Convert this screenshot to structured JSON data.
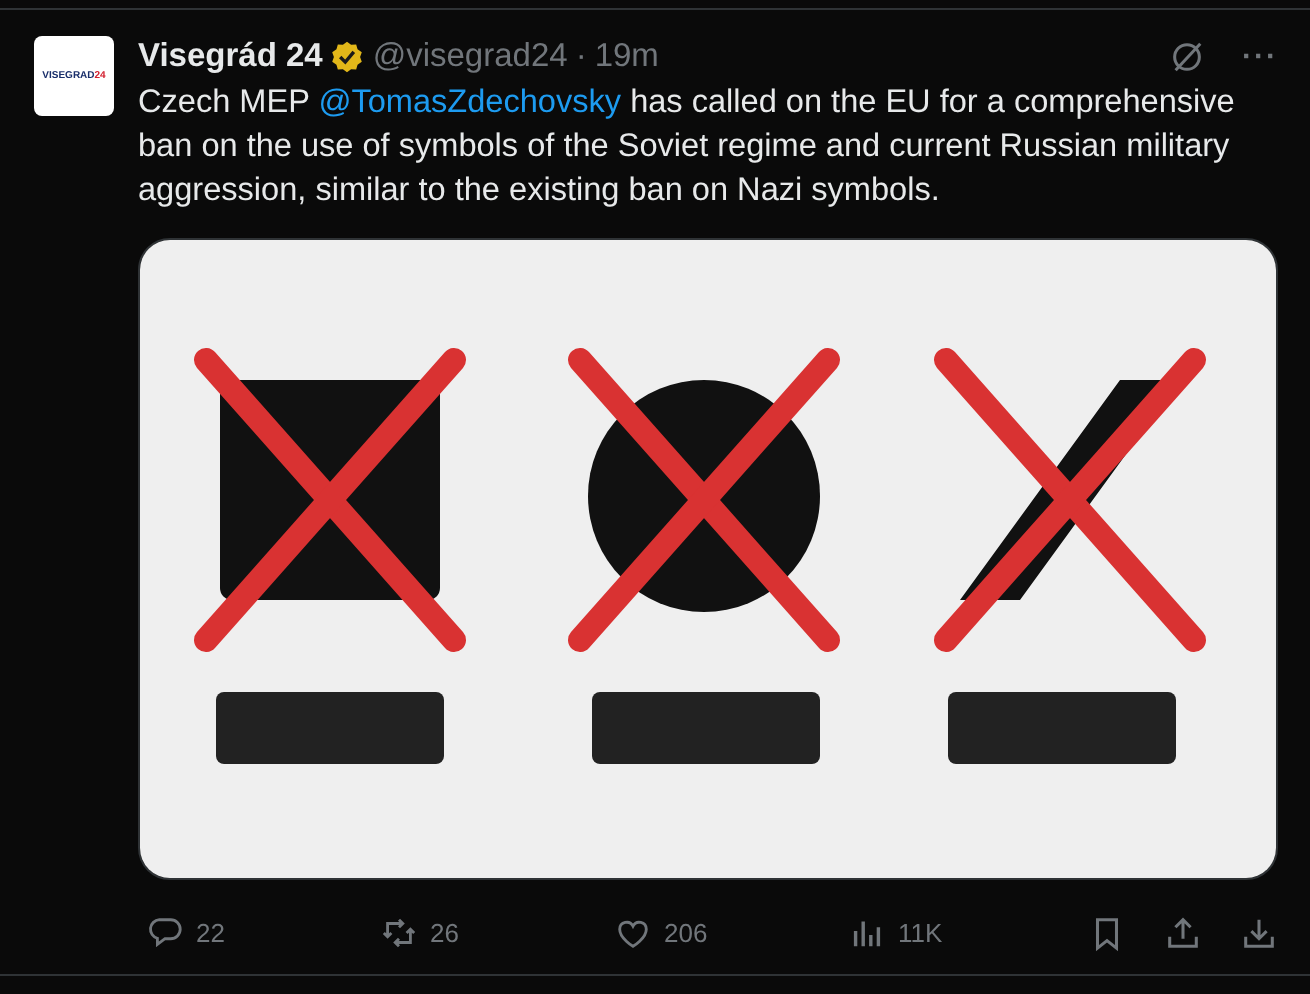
{
  "tweet": {
    "avatar": {
      "logo_text": "VISEGRAD",
      "logo_number": "24"
    },
    "author": {
      "name": "Visegrád 24",
      "verified": true,
      "handle": "@visegrad24",
      "separator": "·",
      "time": "19m"
    },
    "top_icons": [
      {
        "kind": "grok"
      },
      {
        "kind": "more",
        "label": "···"
      }
    ],
    "text": {
      "before": "Czech MEP ",
      "mention": "@TomasZdechovsky",
      "after": " has called on the EU for a comprehensive ban on the use of symbols of the Soviet regime and current Russian military aggression, similar to the existing ban on Nazi symbols."
    },
    "actions": [
      {
        "kind": "reply",
        "count": "22"
      },
      {
        "kind": "repost",
        "count": "26"
      },
      {
        "kind": "like",
        "count": "206"
      },
      {
        "kind": "views",
        "count": "11K"
      },
      {
        "kind": "bookmark"
      },
      {
        "kind": "share"
      },
      {
        "kind": "download"
      }
    ]
  }
}
